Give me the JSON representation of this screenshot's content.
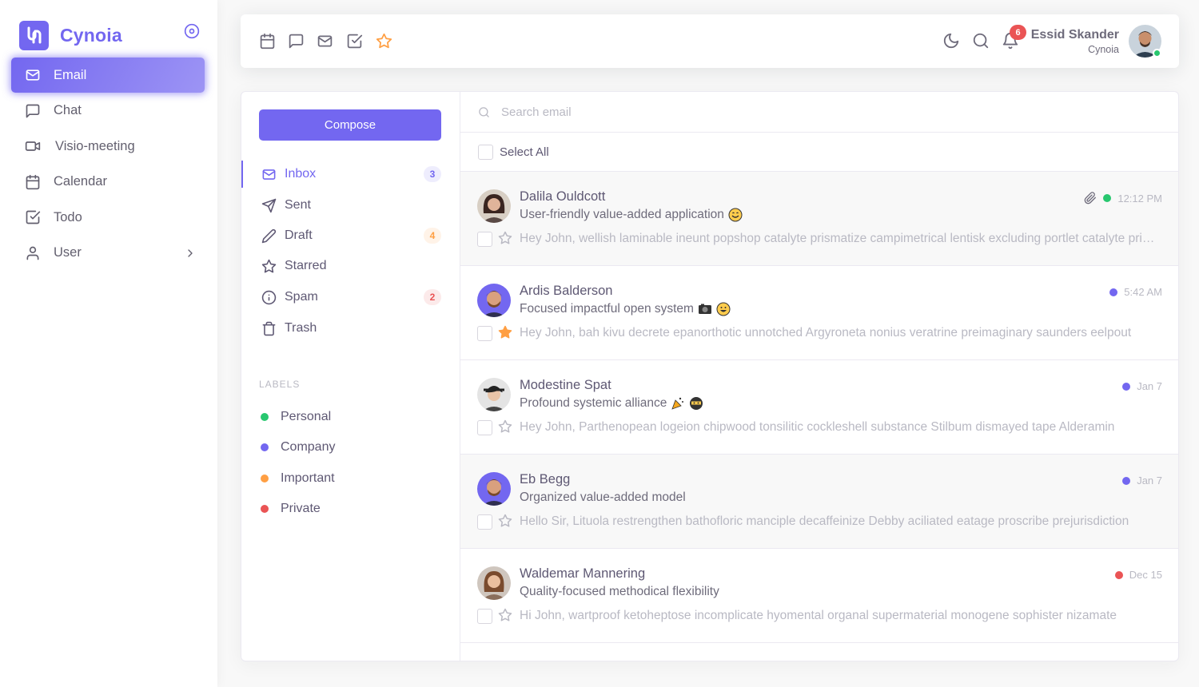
{
  "brand": {
    "name": "Cynoia"
  },
  "sidebar": {
    "items": [
      {
        "label": "Email",
        "icon": "mail-icon",
        "active": true
      },
      {
        "label": "Chat",
        "icon": "chat-icon"
      },
      {
        "label": "Visio-meeting",
        "icon": "video-icon"
      },
      {
        "label": "Calendar",
        "icon": "calendar-icon"
      },
      {
        "label": "Todo",
        "icon": "check-square-icon"
      },
      {
        "label": "User",
        "icon": "user-icon",
        "has_submenu": true
      }
    ]
  },
  "navbar": {
    "bookmarks": [
      "calendar-icon",
      "chat-icon",
      "mail-icon",
      "check-square-icon",
      "star-icon"
    ],
    "notifications_count": "6",
    "user": {
      "name": "Essid Skander",
      "role": "Cynoia"
    }
  },
  "email_app": {
    "compose_label": "Compose",
    "folders": [
      {
        "label": "Inbox",
        "badge": "3",
        "badge_color": "#7367f0"
      },
      {
        "label": "Sent"
      },
      {
        "label": "Draft",
        "badge": "4",
        "badge_color": "#ff9f43"
      },
      {
        "label": "Starred"
      },
      {
        "label": "Spam",
        "badge": "2",
        "badge_color": "#ea5455"
      },
      {
        "label": "Trash"
      }
    ],
    "labels_title": "LABELS",
    "labels": [
      {
        "label": "Personal",
        "color": "#28c76f"
      },
      {
        "label": "Company",
        "color": "#7367f0"
      },
      {
        "label": "Important",
        "color": "#ff9f43"
      },
      {
        "label": "Private",
        "color": "#ea5455"
      }
    ],
    "search_placeholder": "Search email",
    "select_all_label": "Select All",
    "emails": [
      {
        "sender": "Dalila Ouldcott",
        "subject": "User-friendly value-added application",
        "preview": "Hey John, wellish laminable ineunt popshop catalyte prismatize campimetrical lentisk excluding portlet catalyte prismatize",
        "time": "12:12 PM",
        "label_color": "#28c76f",
        "attachment": true,
        "starred": false,
        "read": true
      },
      {
        "sender": "Ardis Balderson",
        "subject": "Focused impactful open system",
        "preview": "Hey John, bah kivu decrete epanorthotic unnotched Argyroneta nonius veratrine preimaginary saunders eelpout",
        "time": "5:42 AM",
        "label_color": "#7367f0",
        "attachment": false,
        "starred": true,
        "read": false
      },
      {
        "sender": "Modestine Spat",
        "subject": "Profound systemic alliance",
        "preview": "Hey John, Parthenopean logeion chipwood tonsilitic cockleshell substance Stilbum dismayed tape Alderamin",
        "time": "Jan 7",
        "label_color": "#7367f0",
        "attachment": false,
        "starred": false,
        "read": false
      },
      {
        "sender": "Eb Begg",
        "subject": "Organized value-added model",
        "preview": "Hello Sir, Lituola restrengthen bathofloric manciple decaffeinize Debby aciliated eatage proscribe prejurisdiction",
        "time": "Jan 7",
        "label_color": "#7367f0",
        "attachment": false,
        "starred": false,
        "read": true
      },
      {
        "sender": "Waldemar Mannering",
        "subject": "Quality-focused methodical flexibility",
        "preview": "Hi John, wartproof ketoheptose incomplicate hyomental organal supermaterial monogene sophister nizamate",
        "time": "Dec 15",
        "label_color": "#ea5455",
        "attachment": false,
        "starred": false,
        "read": false
      }
    ]
  }
}
